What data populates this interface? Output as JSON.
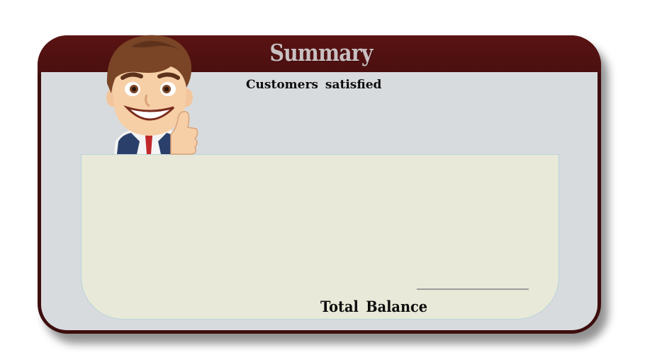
{
  "summary_card": {
    "title": "Summary",
    "customers_label": "Customers  satisfied",
    "total_balance_label": "Total  Balance"
  },
  "colors": {
    "header": "#5a1313",
    "frame": "#3d0d0d",
    "inner_background": "#d8dbdd",
    "panel_background": "#e8e9d8",
    "title_text": "#c9bfc1"
  },
  "icons": {
    "mascot": "cartoon-businessman-thumbs-up"
  }
}
